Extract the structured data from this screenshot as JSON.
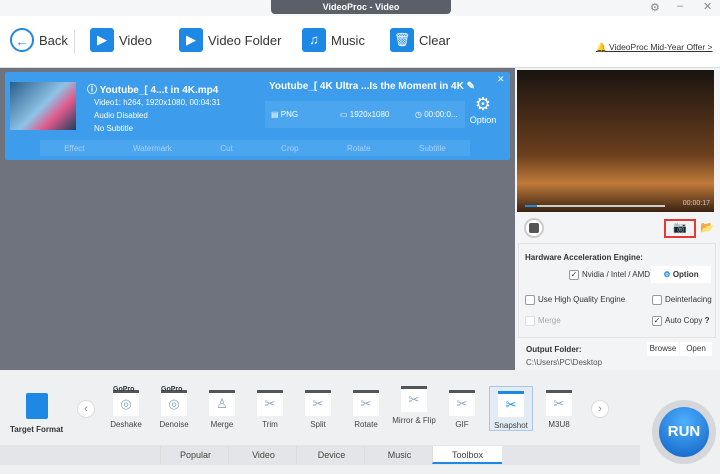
{
  "window": {
    "title": "VideoProc - Video"
  },
  "toolbar": {
    "back": "Back",
    "video": "Video",
    "video_folder": "Video Folder",
    "music": "Music",
    "clear": "Clear",
    "offer": "VideoProc Mid-Year Offer >"
  },
  "item": {
    "source_name": "Youtube_[ 4...t in 4K.mp4",
    "video_track": "Video1: h264, 1920x1080, 00:04:31",
    "audio": "Audio Disabled",
    "subtitle": "No Subtitle",
    "output_name": "Youtube_[ 4K Ultra ...Is the Moment in 4K",
    "format": "PNG",
    "resolution": "1920x1080",
    "duration": "00:00:0...",
    "option": "Option",
    "codec": "codec",
    "edit_tools": [
      "Effect",
      "Watermark",
      "Cut",
      "Crop",
      "Rotate",
      "Subtitle"
    ]
  },
  "preview": {
    "time": "00:00:17"
  },
  "settings": {
    "hw_title": "Hardware Acceleration Engine:",
    "hw_vendor": "Nvidia / Intel / AMD",
    "option": "Option",
    "high_quality": "Use High Quality Engine",
    "deinterlacing": "Deinterlacing",
    "merge": "Merge",
    "auto_copy": "Auto Copy",
    "help": "?",
    "output_label": "Output Folder:",
    "browse": "Browse",
    "open": "Open",
    "output_path": "C:\\Users\\PC\\Desktop"
  },
  "bottom": {
    "target_format": "Target Format",
    "tools": [
      "Deshake",
      "Denoise",
      "Merge",
      "Trim",
      "Split",
      "Rotate",
      "Mirror & Flip",
      "GIF",
      "Snapshot",
      "M3U8"
    ],
    "gopro": "GoPro",
    "tabs": [
      "Popular",
      "Video",
      "Device",
      "Music",
      "Toolbox"
    ],
    "run": "RUN"
  }
}
